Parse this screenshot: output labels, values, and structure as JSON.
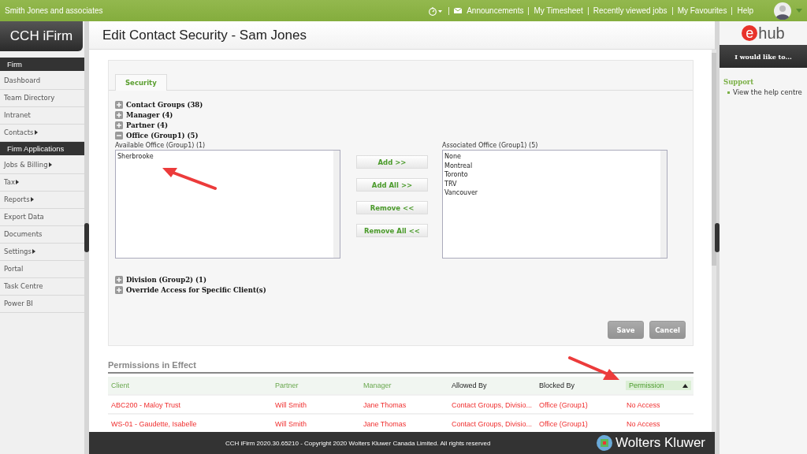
{
  "topbar": {
    "firm": "Smith Jones and associates",
    "links": [
      "Announcements",
      "My Timesheet",
      "Recently viewed jobs",
      "My Favourites",
      "Help"
    ]
  },
  "logo": "CCH iFirm",
  "sidebar": [
    {
      "label": "Firm",
      "kind": "header"
    },
    {
      "label": "Dashboard",
      "kind": "item",
      "submenu": false
    },
    {
      "label": "Team Directory",
      "kind": "item",
      "submenu": false
    },
    {
      "label": "Intranet",
      "kind": "item",
      "submenu": false
    },
    {
      "label": "Contacts",
      "kind": "item",
      "submenu": true
    },
    {
      "label": "Firm Applications",
      "kind": "header"
    },
    {
      "label": "Jobs & Billing",
      "kind": "item",
      "submenu": true
    },
    {
      "label": "Tax",
      "kind": "item",
      "submenu": true
    },
    {
      "label": "Reports",
      "kind": "item",
      "submenu": true
    },
    {
      "label": "Export Data",
      "kind": "item",
      "submenu": false
    },
    {
      "label": "Documents",
      "kind": "item",
      "submenu": false
    },
    {
      "label": "Settings",
      "kind": "item",
      "submenu": true
    },
    {
      "label": "Portal",
      "kind": "item",
      "submenu": false
    },
    {
      "label": "Task Centre",
      "kind": "item",
      "submenu": false
    },
    {
      "label": "Power BI",
      "kind": "item",
      "submenu": false
    }
  ],
  "page_title": "Edit Contact Security - Sam Jones",
  "tabs": [
    {
      "label": "Security",
      "selected": true
    }
  ],
  "groups_before": [
    {
      "label": "Contact Groups (38)",
      "expanded": false
    },
    {
      "label": "Manager (4)",
      "expanded": false
    },
    {
      "label": "Partner (4)",
      "expanded": false
    },
    {
      "label": "Office (Group1) (5)",
      "expanded": true
    }
  ],
  "available": {
    "label": "Available Office (Group1) (1)",
    "items": [
      "Sherbrooke"
    ]
  },
  "move_buttons": [
    "Add >>",
    "Add All >>",
    "Remove <<",
    "Remove All <<"
  ],
  "associated": {
    "label": "Associated Office (Group1) (5)",
    "items": [
      "None",
      "Montreal",
      "Toronto",
      "TRV",
      "Vancouver"
    ]
  },
  "groups_after": [
    {
      "label": "Division (Group2) (1)",
      "expanded": false
    },
    {
      "label": "Override Access for Specific Client(s)",
      "expanded": false
    }
  ],
  "actions": [
    "Save",
    "Cancel"
  ],
  "permissions": {
    "title": "Permissions in Effect",
    "columns": [
      {
        "label": "Client",
        "sortable": true,
        "sorted": false
      },
      {
        "label": "Partner",
        "sortable": true,
        "sorted": false
      },
      {
        "label": "Manager",
        "sortable": true,
        "sorted": false
      },
      {
        "label": "Allowed By",
        "sortable": false,
        "sorted": false
      },
      {
        "label": "Blocked By",
        "sortable": false,
        "sorted": false
      },
      {
        "label": "Permission",
        "sortable": true,
        "sorted": true
      }
    ],
    "rows": [
      [
        "ABC200 - Maloy Trust",
        "Will Smith",
        "Jane Thomas",
        "Contact Groups, Divisio...",
        "Office (Group1)",
        "No Access"
      ],
      [
        "WS-01 - Gaudette, Isabelle",
        "Will Smith",
        "Jane Thomas",
        "Contact Groups, Divisio...",
        "Office (Group1)",
        "No Access"
      ]
    ]
  },
  "footer": {
    "copyright": "CCH iFirm 2020.30.65210 - Copyright 2020 Wolters Kluwer Canada Limited. All rights reserved",
    "brand": "Wolters Kluwer"
  },
  "right_panel": {
    "logo_mark": "e",
    "logo_text": "hub",
    "menu_title": "I would like to...",
    "section": "Support",
    "links": [
      "View the help centre"
    ]
  }
}
